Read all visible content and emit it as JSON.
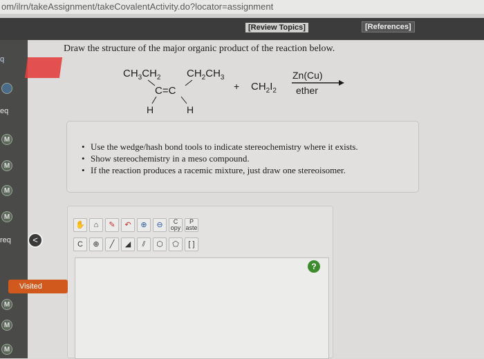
{
  "url": {
    "text": "om/ilrn/takeAssignment/takeCovalentActivity.do?locator=assignment"
  },
  "header": {
    "review_topics": "[Review Topics]",
    "references": "[References]"
  },
  "sidebar": {
    "items": [
      {
        "label": "q"
      },
      {
        "label": ""
      },
      {
        "label": "eq"
      },
      {
        "label": "M"
      },
      {
        "label": "M"
      },
      {
        "label": "M"
      },
      {
        "label": "M"
      },
      {
        "label": "req"
      },
      {
        "label": "M"
      },
      {
        "label": "M"
      },
      {
        "label": "M"
      }
    ],
    "visited_label": "Visited",
    "collapse_glyph": "<"
  },
  "question": {
    "prompt": "Draw the structure of the major organic product of the reaction below.",
    "reagent_plus": "+",
    "reagent_label": "Zn(Cu)",
    "solvent_label": "ether",
    "h_left": "H",
    "h_right": "H",
    "double_bond": "C=C"
  },
  "instructions": [
    "Use the wedge/hash bond tools to indicate stereochemistry where it exists.",
    "Show stereochemistry in a meso compound.",
    "If the reaction produces a racemic mixture, just draw one stereoisomer."
  ],
  "toolbar": {
    "row1": [
      "hand-tool",
      "erase-tool",
      "pencil-tool",
      "undo-tool",
      "zoom-in-tool",
      "zoom-out-tool"
    ],
    "copy_label": "C",
    "copy_sub": "opy",
    "paste_label": "P",
    "paste_sub": "aste",
    "row2_element": "C",
    "row2_plus": "⊕",
    "bracket_label": "[ ]"
  },
  "help_label": "?"
}
